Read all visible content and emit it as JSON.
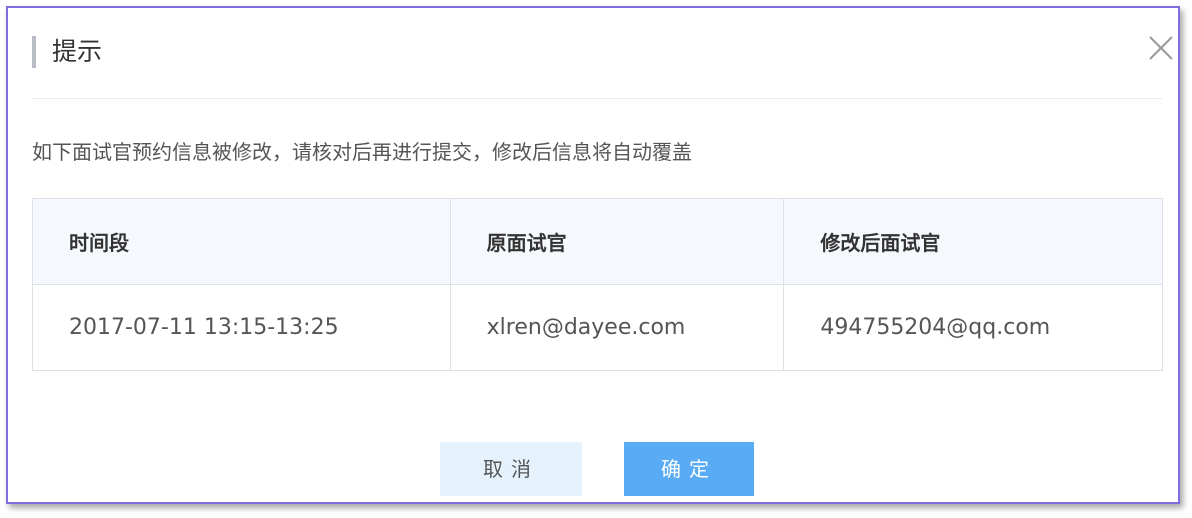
{
  "dialog": {
    "title": "提示",
    "close_icon": "close-icon",
    "message": "如下面试官预约信息被修改，请核对后再进行提交，修改后信息将自动覆盖"
  },
  "table": {
    "headers": [
      "时间段",
      "原面试官",
      "修改后面试官"
    ],
    "rows": [
      [
        "2017-07-11 13:15-13:25",
        "xlren@dayee.com",
        "494755204@qq.com"
      ]
    ]
  },
  "buttons": {
    "cancel_label": "取消",
    "confirm_label": "确定"
  },
  "colors": {
    "accent": "#5aabf5",
    "cancel_bg": "#e5f1fb",
    "dialog_border": "#7e6fe0"
  }
}
